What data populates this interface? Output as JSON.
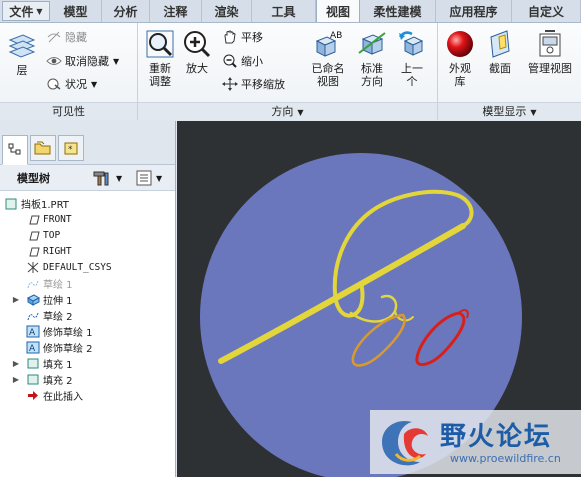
{
  "tabs": [
    {
      "label": "文件",
      "dropdown": true
    },
    {
      "label": "模型"
    },
    {
      "label": "分析"
    },
    {
      "label": "注释"
    },
    {
      "label": "渲染"
    },
    {
      "label": "工具"
    },
    {
      "label": "视图",
      "active": true
    },
    {
      "label": "柔性建模"
    },
    {
      "label": "应用程序"
    },
    {
      "label": "自定义"
    }
  ],
  "ribbon": {
    "visibility": {
      "layers": "层",
      "hide": "隐藏",
      "unhide": "取消隐藏",
      "status": "状况",
      "group_label": "可见性"
    },
    "orientation": {
      "repaint": "重新\n调整",
      "zoom_in": "放大",
      "pan": "平移",
      "zoom_out": "缩小",
      "pan_zoom": "平移缩放",
      "named_views": "已命名\n视图",
      "standard_orientation": "标准\n方向",
      "previous": "上一\n个",
      "group_label": "方向"
    },
    "model_display": {
      "appearance": "外观\n库",
      "section": "截面",
      "manage_views": "管理视图",
      "group_label": "模型显示"
    }
  },
  "model_tree": {
    "title": "模型树",
    "items": [
      {
        "label": "挡板1.PRT",
        "icon": "part-icon",
        "expandable": false,
        "dimmed": false
      },
      {
        "label": "FRONT",
        "icon": "datum-plane-icon",
        "expandable": false,
        "dimmed": false
      },
      {
        "label": "TOP",
        "icon": "datum-plane-icon",
        "expandable": false,
        "dimmed": false
      },
      {
        "label": "RIGHT",
        "icon": "datum-plane-icon",
        "expandable": false,
        "dimmed": false
      },
      {
        "label": "DEFAULT_CSYS",
        "icon": "csys-icon",
        "expandable": false,
        "dimmed": false
      },
      {
        "label": "草绘 1",
        "icon": "sketch-icon",
        "expandable": false,
        "dimmed": true
      },
      {
        "label": "拉伸 1",
        "icon": "extrude-icon",
        "expandable": true,
        "dimmed": false
      },
      {
        "label": "草绘 2",
        "icon": "sketch-icon",
        "expandable": false,
        "dimmed": false
      },
      {
        "label": "修饰草绘 1",
        "icon": "cosmetic-sketch-icon",
        "expandable": false,
        "dimmed": false
      },
      {
        "label": "修饰草绘 2",
        "icon": "cosmetic-sketch-icon",
        "expandable": false,
        "dimmed": false
      },
      {
        "label": "填充 1",
        "icon": "fill-icon",
        "expandable": true,
        "dimmed": false
      },
      {
        "label": "填充 2",
        "icon": "fill-icon",
        "expandable": true,
        "dimmed": false
      },
      {
        "label": "在此插入",
        "icon": "insert-here-arrow-icon",
        "expandable": false,
        "dimmed": false
      }
    ]
  },
  "watermark": {
    "title": "野火论坛",
    "url": "www.proewildfire.cn"
  },
  "colors": {
    "disc": "#6b77bd",
    "curve_yellow": "#e3d63a",
    "curve_red": "#d8201a",
    "background": "#2d3133"
  }
}
